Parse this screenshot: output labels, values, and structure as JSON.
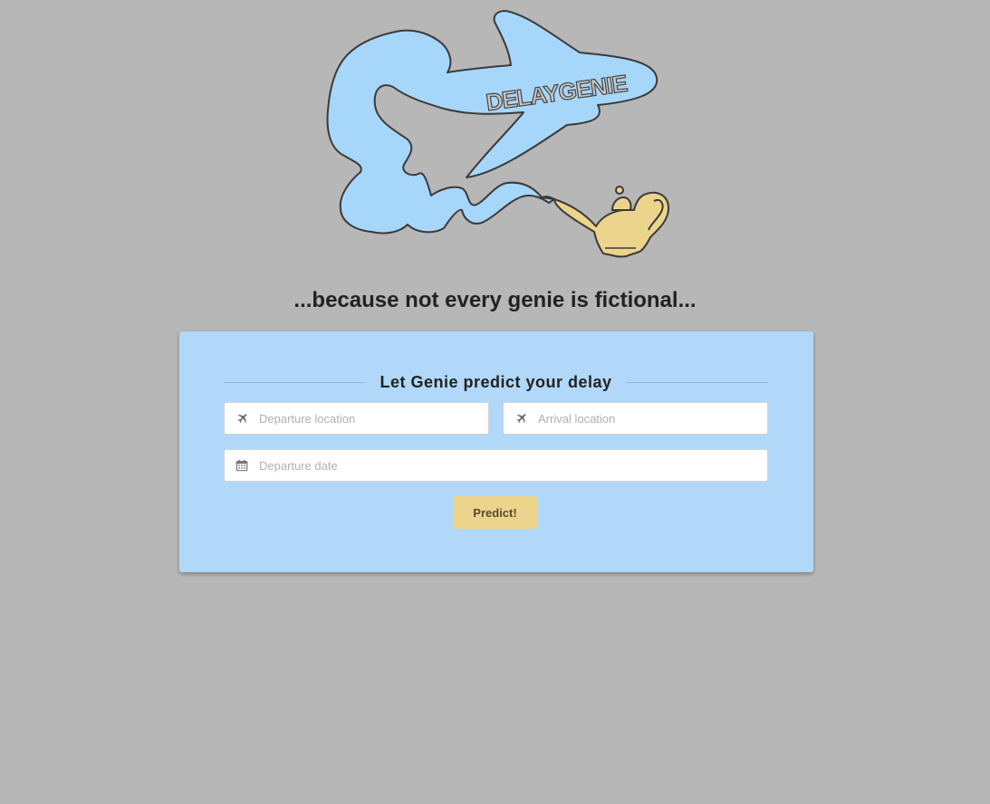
{
  "logo": {
    "text": "DELAYGENIE"
  },
  "tagline": "...because not every genie is fictional...",
  "form": {
    "heading": "Let Genie predict your delay",
    "departure": {
      "placeholder": "Departure location",
      "icon": "plane-icon",
      "value": ""
    },
    "arrival": {
      "placeholder": "Arrival location",
      "icon": "plane-icon",
      "value": ""
    },
    "date": {
      "placeholder": "Departure date",
      "icon": "calendar-icon",
      "value": ""
    },
    "submit_label": "Predict!"
  },
  "colors": {
    "page_background": "#b7b7b7",
    "card_background": "#b1d8f8",
    "button_background": "#ecd48c",
    "genie_blue": "#a6d7fb",
    "lamp_gold": "#ecd48c"
  }
}
